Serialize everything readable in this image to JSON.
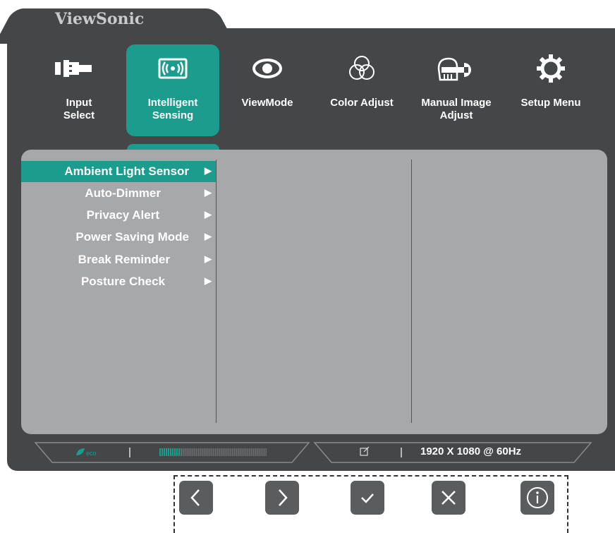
{
  "brand": "ViewSonic",
  "tabs": [
    {
      "label": "Input\nSelect",
      "icon": "input-select-icon",
      "active": false
    },
    {
      "label": "Intelligent\nSensing",
      "icon": "intelligent-sensing-icon",
      "active": true
    },
    {
      "label": "ViewMode",
      "icon": "eye-icon",
      "active": false
    },
    {
      "label": "Color Adjust",
      "icon": "color-circles-icon",
      "active": false
    },
    {
      "label": "Manual Image\nAdjust",
      "icon": "hand-wrench-icon",
      "active": false
    },
    {
      "label": "Setup Menu",
      "icon": "gear-icon",
      "active": false
    }
  ],
  "submenu": [
    {
      "label": "Ambient Light Sensor",
      "selected": true
    },
    {
      "label": "Auto-Dimmer",
      "selected": false
    },
    {
      "label": "Privacy Alert",
      "selected": false
    },
    {
      "label": "Power Saving Mode",
      "selected": false
    },
    {
      "label": "Break Reminder",
      "selected": false
    },
    {
      "label": "Posture Check",
      "selected": false
    }
  ],
  "status": {
    "eco_label": "eco",
    "resolution": "1920 X 1080 @ 60Hz"
  },
  "nav_buttons": [
    "back",
    "forward",
    "confirm",
    "close",
    "info"
  ],
  "colors": {
    "accent": "#1b9c8d",
    "frame": "#444648",
    "panel": "#a7a8aa"
  }
}
